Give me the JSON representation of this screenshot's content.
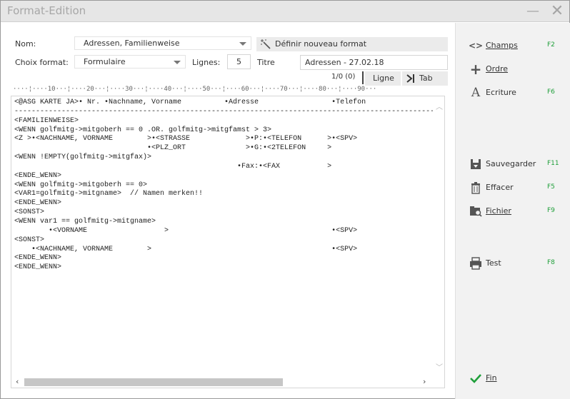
{
  "window": {
    "title": "Format-Edition",
    "minimize": "—",
    "close": "✕"
  },
  "form": {
    "nom_label": "Nom:",
    "nom_value": "Adressen, Familienweise",
    "define_format_label": "Définir nouveau format",
    "choix_label": "Choix format:",
    "choix_value": "Formulaire",
    "lignes_label": "Lignes:",
    "lignes_value": "5",
    "titre_label": "Titre",
    "titre_value": "Adressen - 27.02.18"
  },
  "toolbar": {
    "pager": "1/0 (0)",
    "ligne_label": "Ligne",
    "tab_label": "Tab"
  },
  "ruler": "····¦····10···¦····20···¦····30···¦····40···¦····50···¦····60···¦····70···¦····80···¦····90···",
  "editor_lines": [
    "<@ASG KARTE JA>• Nr. •Nachname, Vorname          •Adresse                 •Telefon",
    "--------------------------------------------------------------------------------------------------",
    "<FAMILIENWEISE>",
    "<WENN golfmitg->mitgoberh == 0 .OR. golfmitg->mitgfamst > 3>",
    "<Z >•<NACHNAME, VORNAME        >•<STRASSE             >•P:•<TELEFON      >•<SPV>",
    "                               •<PLZ_ORT              >•G:•<2TELEFON     >",
    "<WENN !EMPTY(golfmitg->mitgfax)>",
    "                                                    •Fax:•<FAX           >",
    "<ENDE_WENN>",
    "<WENN golfmitg->mitgoberh == 0>",
    "<VAR1=golfmitg->mitgname>  // Namen merken!!",
    "<ENDE_WENN>",
    "<SONST>",
    "<WENN var1 == golfmitg->mitgname>",
    "        •<VORNAME                  >                                      •<SPV>",
    "<SONST>",
    "    •<NACHNAME, VORNAME        >                                          •<SPV>",
    "<ENDE_WENN>",
    "<ENDE_WENN>"
  ],
  "sidebar": {
    "items": [
      {
        "label": "Champs",
        "key": "F2",
        "icon": "code-icon"
      },
      {
        "label": "Ordre",
        "key": "",
        "icon": "plus-icon"
      },
      {
        "label": "Ecriture",
        "key": "F6",
        "icon": "font-icon"
      },
      {
        "label": "Sauvegarder",
        "key": "F11",
        "icon": "save-icon"
      },
      {
        "label": "Effacer",
        "key": "F5",
        "icon": "trash-icon"
      },
      {
        "label": "Fichier",
        "key": "F9",
        "icon": "file-icon"
      },
      {
        "label": "Test",
        "key": "F8",
        "icon": "printer-icon"
      },
      {
        "label": "Fin",
        "key": "",
        "icon": "check-icon"
      }
    ]
  },
  "colors": {
    "accent_green": "#1f9f3a",
    "sidebar_bg": "#f2f2f2",
    "titlebar_bg": "#e6e6e6"
  }
}
